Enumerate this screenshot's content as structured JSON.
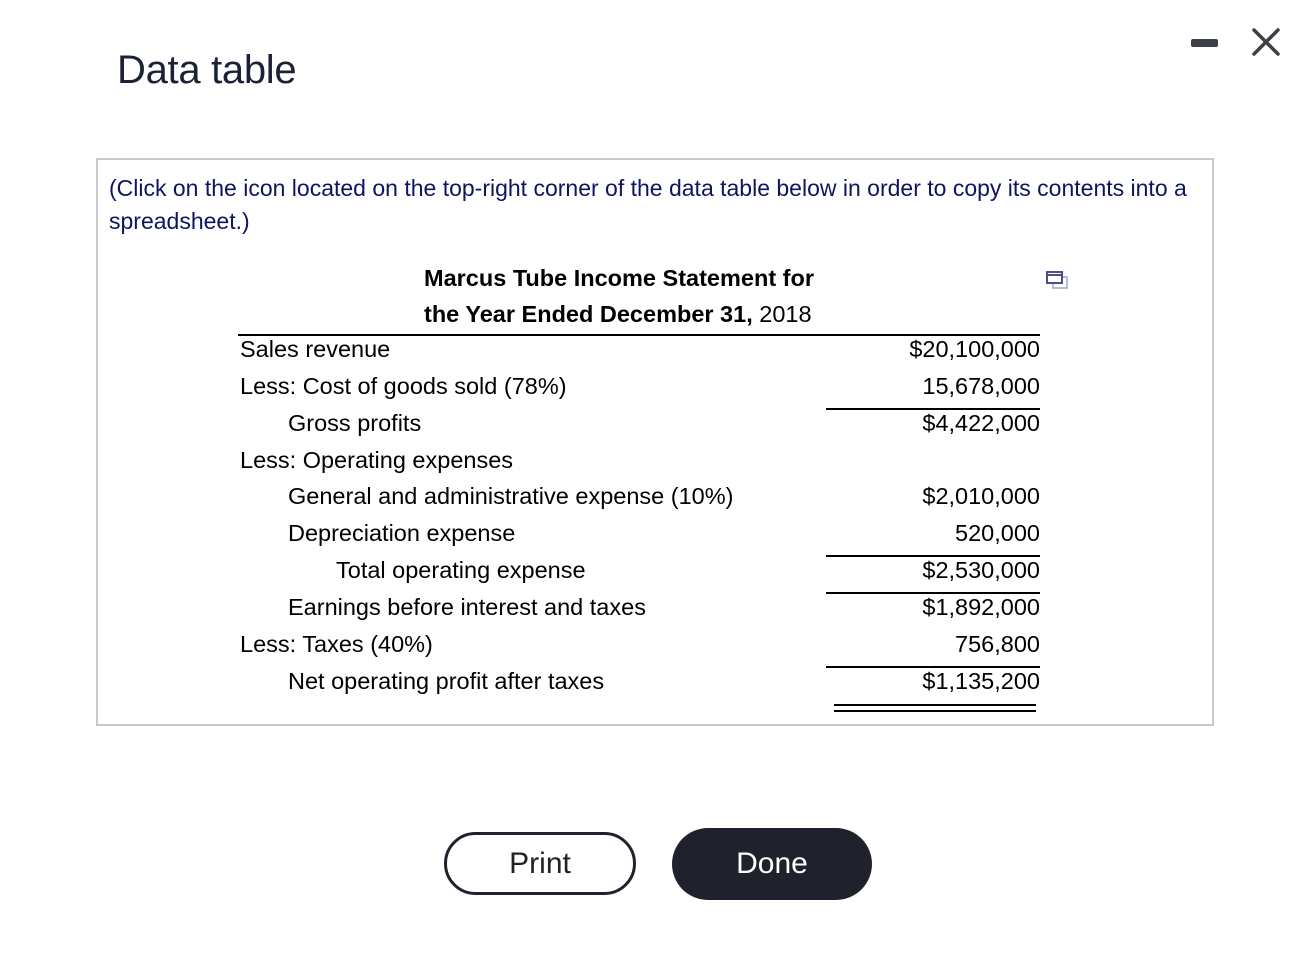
{
  "dialog": {
    "title": "Data table",
    "minimize_icon": "minimize-icon",
    "close_icon": "close-icon"
  },
  "panel": {
    "instructions": "(Click on the icon located on the top-right corner of the data table below in order to copy its contents into a spreadsheet.)",
    "copy_icon": "copy-to-spreadsheet-icon"
  },
  "statement": {
    "title_line1": "Marcus Tube Income Statement for",
    "title_line2_bold": "the Year Ended December 31,",
    "title_line2_year": " 2018",
    "rows": [
      {
        "label": "Sales revenue",
        "amount": "$20,100,000",
        "indent": 0
      },
      {
        "label": "Less: Cost of goods sold (78%)",
        "amount": "15,678,000",
        "indent": 0
      },
      {
        "label": "Gross profits",
        "amount": "$4,422,000",
        "indent": 1
      },
      {
        "label": "Less: Operating expenses",
        "amount": "",
        "indent": 0
      },
      {
        "label": "General and administrative expense (10%)",
        "amount": "$2,010,000",
        "indent": 1
      },
      {
        "label": "Depreciation expense",
        "amount": "520,000",
        "indent": 1
      },
      {
        "label": "Total operating expense",
        "amount": "$2,530,000",
        "indent": 2
      },
      {
        "label": "Earnings before interest and taxes",
        "amount": "$1,892,000",
        "indent": 1
      },
      {
        "label": "Less: Taxes (40%)",
        "amount": "756,800",
        "indent": 0
      },
      {
        "label": "Net operating profit after taxes",
        "amount": "$1,135,200",
        "indent": 1
      }
    ]
  },
  "buttons": {
    "print": "Print",
    "done": "Done"
  }
}
